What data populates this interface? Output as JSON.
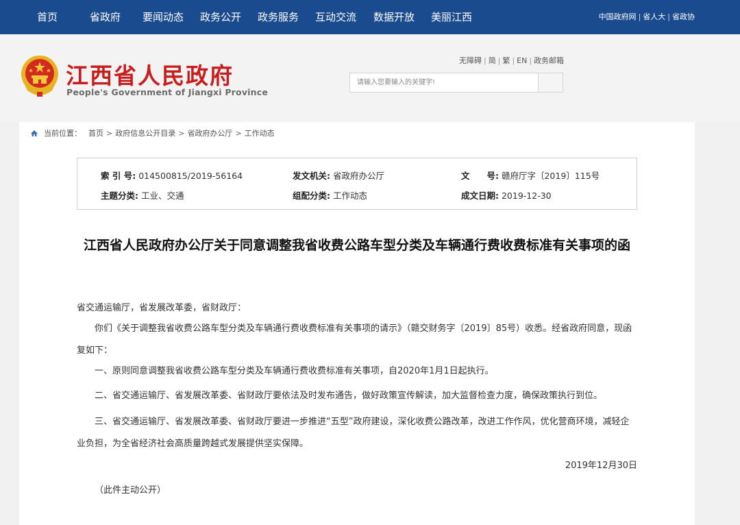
{
  "nav": {
    "items": [
      "首页",
      "省政府",
      "要闻动态",
      "政务公开",
      "政务服务",
      "互动交流",
      "数据开放",
      "美丽江西"
    ],
    "links": [
      "中国政府网",
      "省人大",
      "省政协"
    ]
  },
  "header": {
    "site_name_cn": "江西省人民政府",
    "site_name_en": "People's Government of Jiangxi Province",
    "util_links": [
      "无障碍",
      "简",
      "繁",
      "EN",
      "政务邮箱"
    ],
    "search_placeholder": "请输入您要输入的关键字!"
  },
  "breadcrumb": {
    "label": "当前位置：",
    "items": [
      "首页",
      "政府信息公开目录",
      "省政府办公厅",
      "工作动态"
    ]
  },
  "meta": {
    "index_label": "索 引 号:",
    "index_value": "014500815/2019-56164",
    "issuer_label": "发文机关:",
    "issuer_value": "省政府办公厅",
    "docno_label": "文　　号:",
    "docno_value": "赣府厅字〔2019〕115号",
    "topic_label": "主题分类:",
    "topic_value": "工业、交通",
    "category_label": "组配分类:",
    "category_value": "工作动态",
    "date_label": "成文日期:",
    "date_value": "2019-12-30"
  },
  "article": {
    "title": "江西省人民政府办公厅关于同意调整我省收费公路车型分类及车辆通行费收费标准有关事项的函",
    "recipients": "省交通运输厅，省发展改革委，省财政厅：",
    "para1": "你们《关于调整我省收费公路车型分类及车辆通行费收费标准有关事项的请示》（赣交财务字〔2019〕85号）收悉。经省政府同意，现函复如下：",
    "para2": "一、原则同意调整我省收费公路车型分类及车辆通行费收费标准有关事项，自2020年1月1日起执行。",
    "para3": "二、省交通运输厅、省发展改革委、省财政厅要依法及时发布通告，做好政策宣传解读，加大监督检查力度，确保政策执行到位。",
    "para4": "三、省交通运输厅、省发展改革委、省财政厅要进一步推进“五型”政府建设，深化收费公路改革，改进工作作风，优化营商环境，减轻企业负担，为全省经济社会高质量跨越式发展提供坚实保障。",
    "date": "2019年12月30日",
    "note": "（此件主动公开）"
  },
  "colors": {
    "nav_bg": "#1b4b8f",
    "brand_red": "#c81d1d"
  }
}
